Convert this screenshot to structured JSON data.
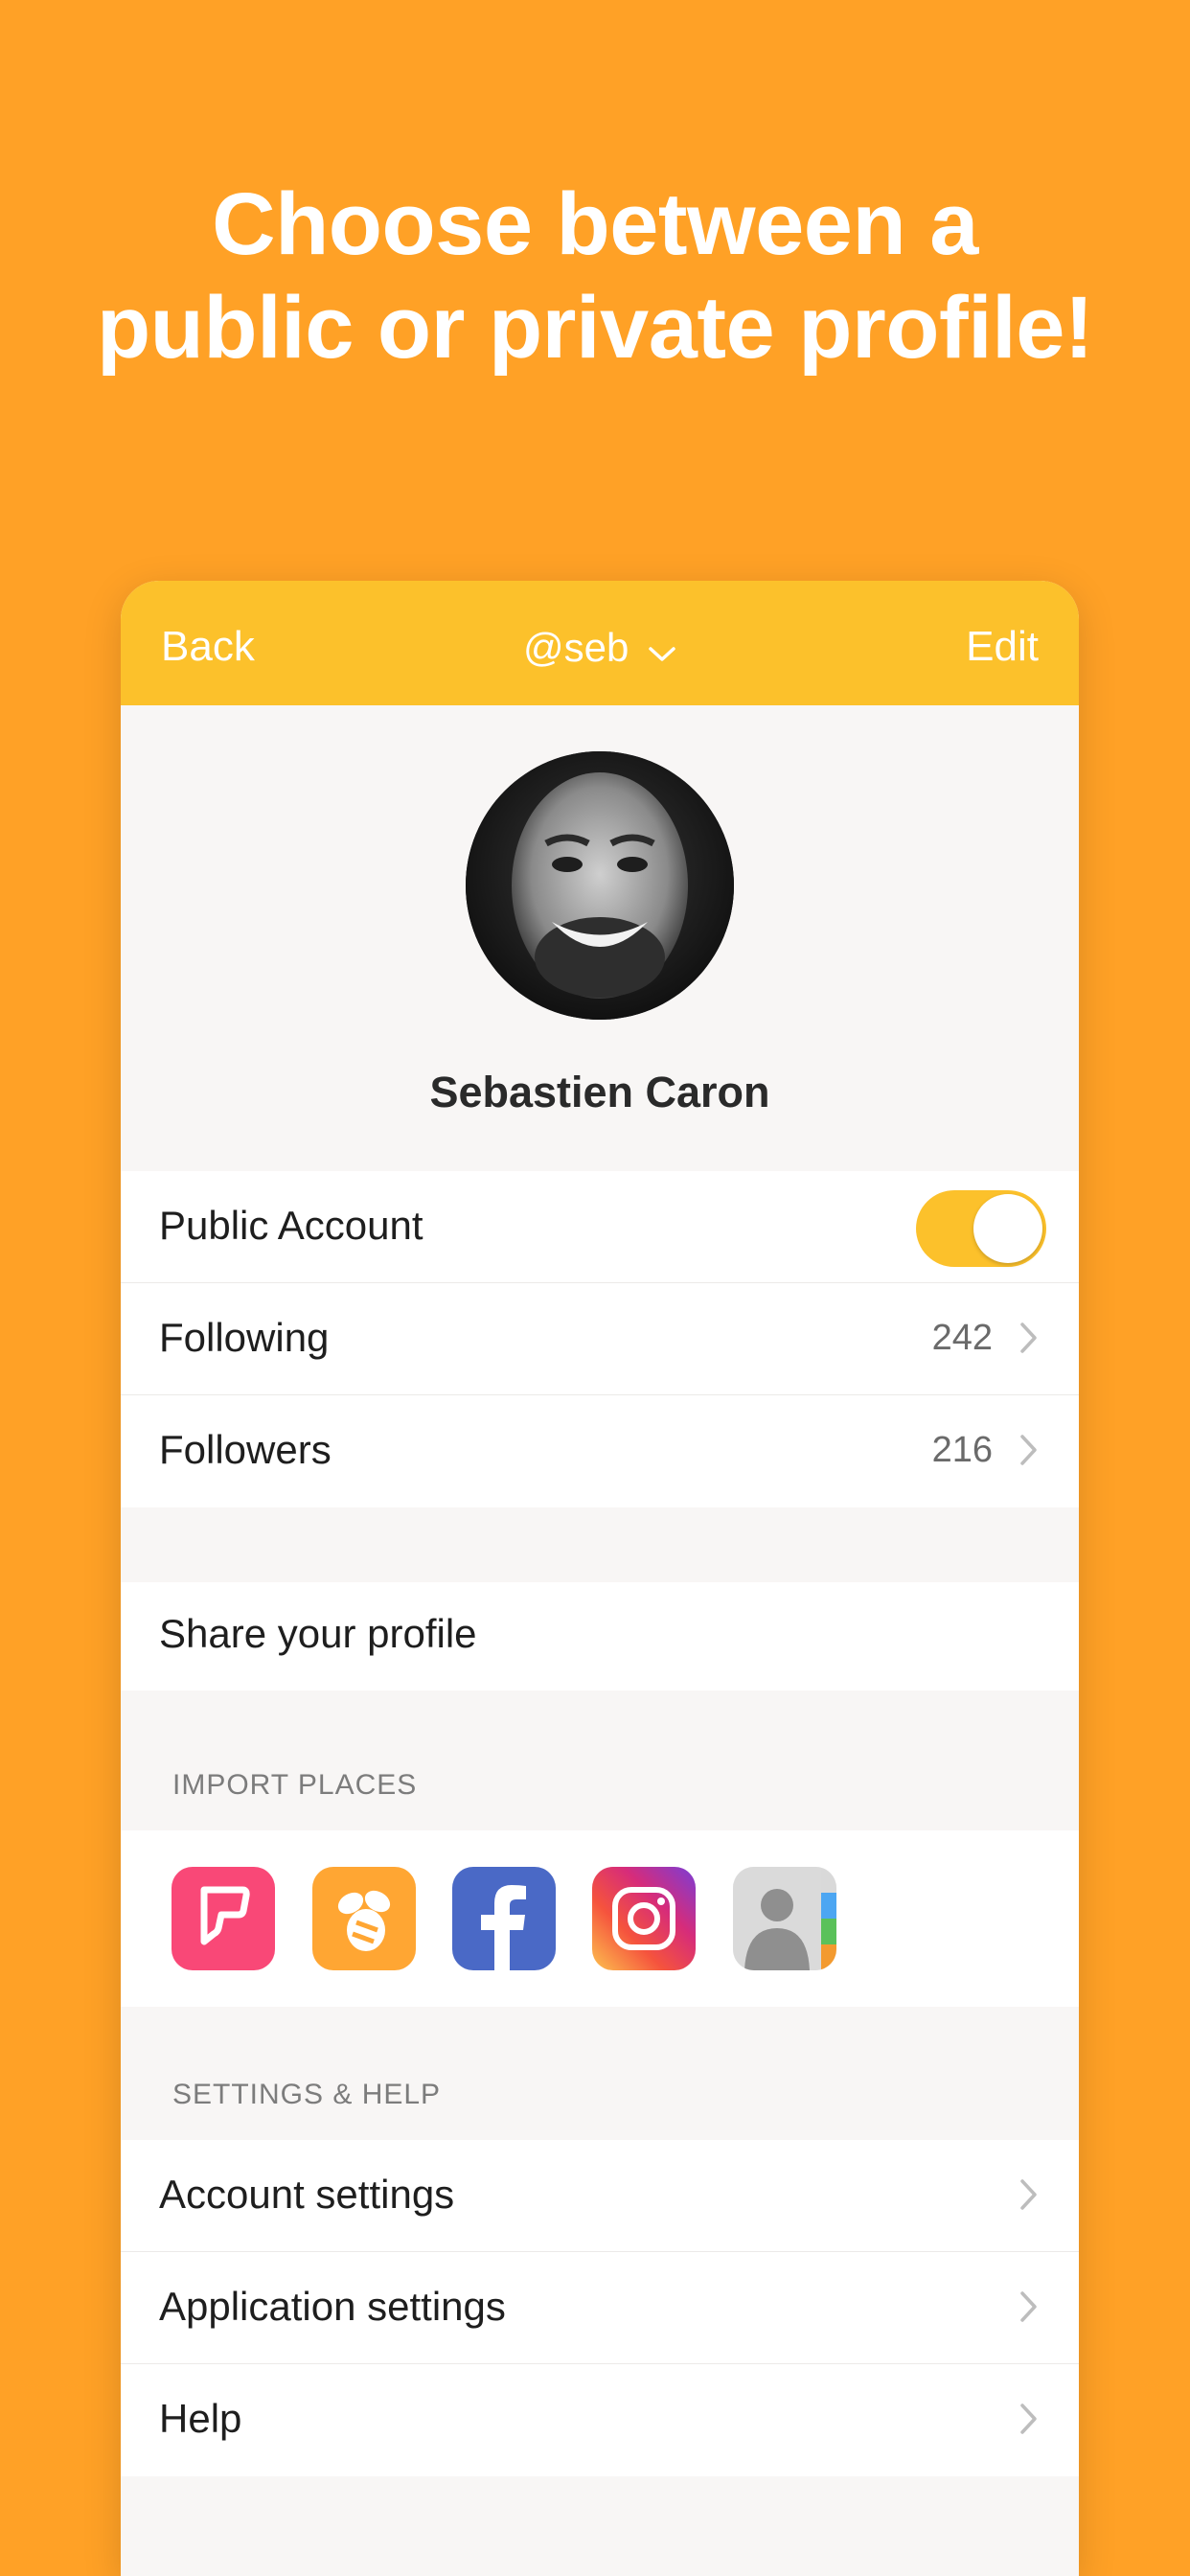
{
  "headline": {
    "line1": "Choose between a",
    "line2": "public or private profile!"
  },
  "navbar": {
    "back": "Back",
    "title": "@seb",
    "edit": "Edit"
  },
  "profile": {
    "name": "Sebastien Caron"
  },
  "account_rows": [
    {
      "label": "Public Account",
      "toggle_on": true
    },
    {
      "label": "Following",
      "count": "242"
    },
    {
      "label": "Followers",
      "count": "216"
    }
  ],
  "share": {
    "label": "Share your profile"
  },
  "import": {
    "caption": "IMPORT PLACES",
    "apps": [
      "foursquare-icon",
      "swarm-icon",
      "facebook-icon",
      "instagram-icon",
      "contacts-icon"
    ]
  },
  "settings": {
    "caption": "SETTINGS & HELP",
    "items": [
      {
        "label": "Account settings"
      },
      {
        "label": "Application settings"
      },
      {
        "label": "Help"
      }
    ]
  },
  "colors": {
    "background": "#FFA126",
    "accent": "#FCC12B",
    "surface": "#F8F6F5"
  }
}
